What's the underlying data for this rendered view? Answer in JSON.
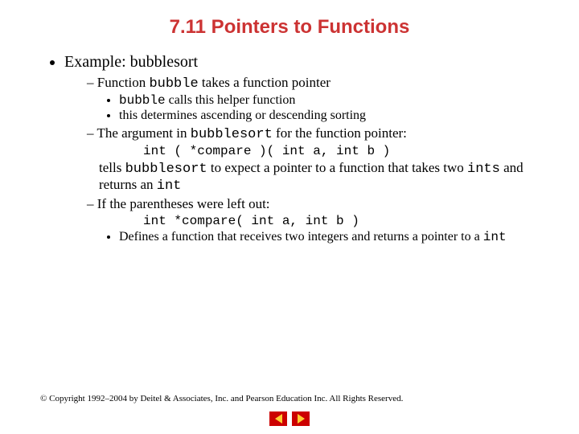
{
  "title": "7.11 Pointers to Functions",
  "bullet1": "Example: bubblesort",
  "sub1": {
    "text_a": "Function ",
    "code_a": "bubble",
    "text_b": " takes a function pointer",
    "subsub1_code": "bubble",
    "subsub1_rest": " calls this helper function",
    "subsub2": "this determines ascending or descending sorting"
  },
  "sub2": {
    "text_a": "The argument in ",
    "code_a": "bubblesort",
    "text_b": " for the function pointer:",
    "codeline": "int ( *compare )( int a, int b )",
    "cont_a": "tells ",
    "cont_code1": "bubblesort",
    "cont_b": " to expect a pointer to a function that takes two ",
    "cont_code2": "ints",
    "cont_c": " and returns an ",
    "cont_code3": "int"
  },
  "sub3": {
    "text": "If the parentheses were left out:",
    "codeline": "int *compare( int a, int b )",
    "subsub_a": "Defines a function that receives two integers and returns a pointer to a ",
    "subsub_code": "int"
  },
  "footer": "© Copyright 1992–2004 by Deitel & Associates, Inc. and Pearson Education Inc. All Rights Reserved."
}
